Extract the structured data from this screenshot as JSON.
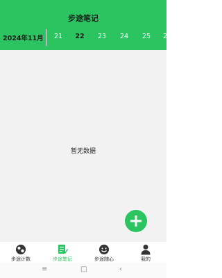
{
  "header": {
    "title": "步途笔记"
  },
  "datebar": {
    "month": "2024年11月",
    "days": [
      {
        "label": "21",
        "selected": false
      },
      {
        "label": "22",
        "selected": true
      },
      {
        "label": "23",
        "selected": false
      },
      {
        "label": "24",
        "selected": false
      },
      {
        "label": "25",
        "selected": false
      },
      {
        "label": "2",
        "selected": false
      }
    ]
  },
  "content": {
    "empty_text": "暂无数据"
  },
  "fab": {
    "icon": "plus-icon",
    "color": "#2cc460"
  },
  "tabs": [
    {
      "label": "步途计数",
      "icon": "ball-icon",
      "active": false
    },
    {
      "label": "步途笔记",
      "icon": "note-edit-icon",
      "active": true
    },
    {
      "label": "步途随心",
      "icon": "smile-icon",
      "active": false
    },
    {
      "label": "我的",
      "icon": "person-icon",
      "active": false
    }
  ],
  "system_nav": {
    "menu": "≡",
    "home": "□",
    "back": "‹"
  },
  "colors": {
    "accent": "#2cc460",
    "background": "#f2f2f2"
  }
}
